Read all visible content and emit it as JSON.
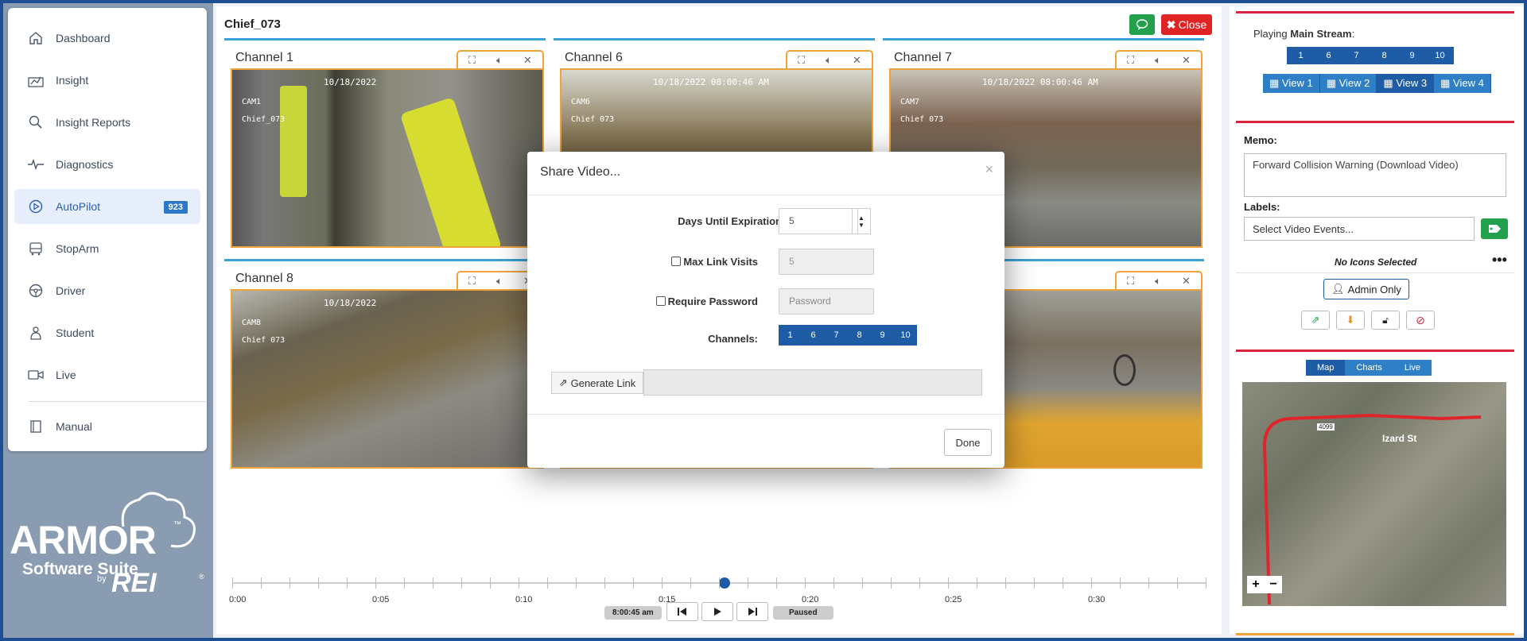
{
  "sidebar": {
    "items": [
      {
        "label": "Dashboard",
        "icon": "home-icon"
      },
      {
        "label": "Insight",
        "icon": "chart-icon"
      },
      {
        "label": "Insight Reports",
        "icon": "search-icon"
      },
      {
        "label": "Diagnostics",
        "icon": "pulse-icon"
      },
      {
        "label": "AutoPilot",
        "icon": "play-circle-icon",
        "badge": "923",
        "active": true
      },
      {
        "label": "StopArm",
        "icon": "bus-icon"
      },
      {
        "label": "Driver",
        "icon": "steering-wheel-icon"
      },
      {
        "label": "Student",
        "icon": "student-icon"
      },
      {
        "label": "Live",
        "icon": "video-icon"
      },
      {
        "label": "Manual",
        "icon": "book-icon"
      }
    ]
  },
  "logo": {
    "brand": "ARMOR",
    "trademark": "™",
    "suite": "Software Suite",
    "by": "by",
    "company": "REI",
    "registered": "®"
  },
  "main": {
    "title": "Chief_073",
    "close_label": "Close"
  },
  "channels": [
    {
      "name": "Channel 1",
      "ts": "10/18/2022",
      "cam": "CAM1",
      "vehicle": "Chief_073"
    },
    {
      "name": "Channel 6",
      "ts": "10/18/2022  08:00:46 AM",
      "cam": "CAM6",
      "vehicle": "Chief    073"
    },
    {
      "name": "Channel 7",
      "ts": "10/18/2022  08:00:46 AM",
      "cam": "CAM7",
      "vehicle": "Chief    073"
    },
    {
      "name": "Channel 8",
      "ts": "10/18/2022",
      "cam": "CAM8",
      "vehicle": "Chief  073"
    },
    {
      "name": "",
      "ts": "",
      "cam": "",
      "vehicle": ""
    },
    {
      "name": "",
      "ts": "",
      "cam": "",
      "vehicle": ""
    }
  ],
  "timeline": {
    "ticks": [
      "0:00",
      "0:05",
      "0:10",
      "0:15",
      "0:20",
      "0:25",
      "0:30"
    ],
    "current_time": "8:00:45 am",
    "status": "Paused"
  },
  "right": {
    "playing_prefix": "Playing ",
    "playing_stream": "Main Stream",
    "channel_buttons": [
      "1",
      "6",
      "7",
      "8",
      "9",
      "10"
    ],
    "views": [
      "View 1",
      "View 2",
      "View 3",
      "View 4"
    ],
    "active_view": "View 3",
    "memo_label": "Memo:",
    "memo_value": "Forward Collision Warning (Download Video)",
    "labels_label": "Labels:",
    "labels_placeholder": "Select Video Events...",
    "no_icons": "No Icons Selected",
    "admin_only": "Admin Only",
    "map_tabs": [
      "Map",
      "Charts",
      "Live"
    ],
    "street": "Izard St",
    "route": "4099"
  },
  "modal": {
    "title": "Share Video...",
    "days_label": "Days Until Expiration",
    "days_value": "5",
    "max_visits_label": "Max Link Visits",
    "max_visits_value": "5",
    "password_label": "Require Password",
    "password_placeholder": "Password",
    "channels_label": "Channels:",
    "channels": [
      "1",
      "6",
      "7",
      "8",
      "9",
      "10"
    ],
    "generate_label": "Generate Link",
    "done_label": "Done"
  }
}
